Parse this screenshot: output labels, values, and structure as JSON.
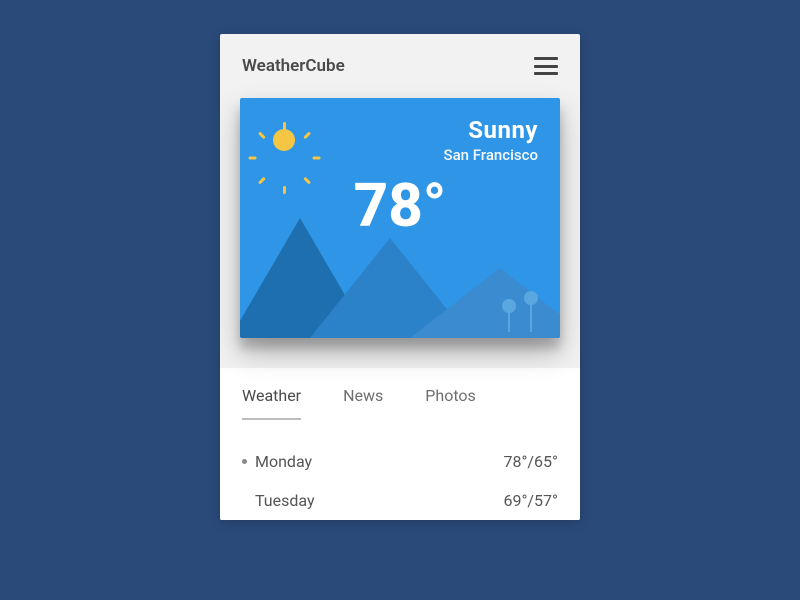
{
  "header": {
    "title": "WeatherCube"
  },
  "hero": {
    "condition": "Sunny",
    "location": "San Francisco",
    "temperature": "78°"
  },
  "tabs": [
    {
      "label": "Weather",
      "active": true
    },
    {
      "label": "News",
      "active": false
    },
    {
      "label": "Photos",
      "active": false
    }
  ],
  "forecast": [
    {
      "day": "Monday",
      "hi_lo": "78°/65°",
      "current": true
    },
    {
      "day": "Tuesday",
      "hi_lo": "69°/57°",
      "current": false
    }
  ]
}
